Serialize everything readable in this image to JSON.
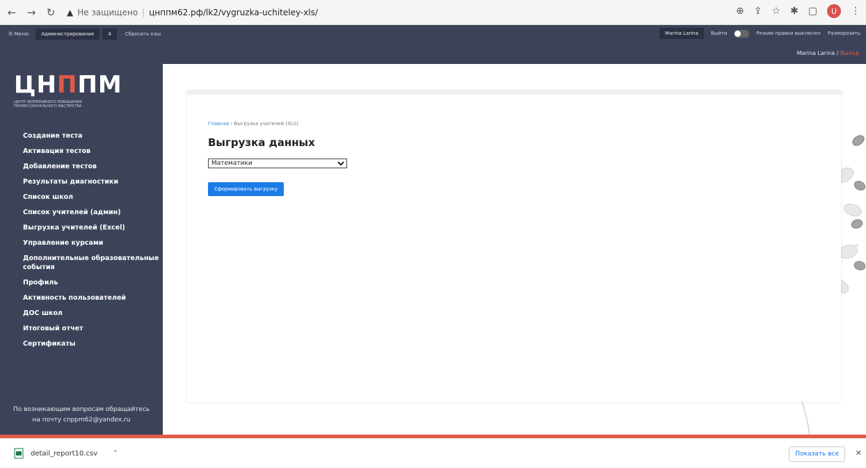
{
  "browser": {
    "insecure_label": "Не защищено",
    "url": "цнппм62.рф/lk2/vygruzka-uchiteley-xls/",
    "profile_initial": "U"
  },
  "admin_bar": {
    "menu": "☰ Меню",
    "admin": "Администрирование",
    "count": "4",
    "reset": "Сбросить кэш",
    "user": "Marina Larina",
    "logout": "Выйти",
    "mode": "Режим правки выключен",
    "edit": "Разморозить"
  },
  "header": {
    "user_name": "Marina Larina /",
    "logout": "Выход"
  },
  "logo": {
    "word_a": "ЦН",
    "word_b": "П",
    "word_c": "ПМ",
    "subtitle": "ЦЕНТР НЕПРЕРЫВНОГО ПОВЫШЕНИЯ ПРОФЕССИОНАЛЬНОГО МАСТЕРСТВА"
  },
  "sidebar": {
    "items": [
      {
        "label": "Создание теста"
      },
      {
        "label": "Активация тестов"
      },
      {
        "label": "Добавление тестов"
      },
      {
        "label": "Результаты диагностики"
      },
      {
        "label": "Список школ"
      },
      {
        "label": "Список учителей (админ)"
      },
      {
        "label": "Выгрузка учителей (Excel)"
      },
      {
        "label": "Управление курсами"
      },
      {
        "label": "Дополнительные образовательные события"
      },
      {
        "label": "Профиль"
      },
      {
        "label": "Активность пользователей"
      },
      {
        "label": "ДОС школ"
      },
      {
        "label": "Итоговый отчет"
      },
      {
        "label": "Сертификаты"
      }
    ],
    "support_line1": "По возникающим вопросам обращайтесь",
    "support_line2": "на почту cnppm62@yandex.ru"
  },
  "main": {
    "breadcrumb_home": "Главная",
    "breadcrumb_sep": "›",
    "breadcrumb_current": "Выгрузка учителей (XLS)",
    "title": "Выгрузка данных",
    "select_value": "Математики",
    "button_label": "Сформировать выгрузку"
  },
  "downloads": {
    "file": "detail_report10.csv",
    "show_all": "Показать все"
  }
}
